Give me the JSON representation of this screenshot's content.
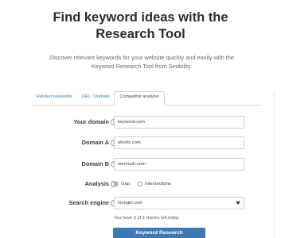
{
  "hero": {
    "title_line1": "Find keyword ideas with the",
    "title_line2": "Research Tool",
    "subtitle_line1": "Discover relevant keywords for your website quickly and easily with the",
    "subtitle_line2": "Keyword Research Tool from Seobility."
  },
  "tabs": [
    {
      "label": "Related keywords",
      "active": false
    },
    {
      "label": "URL / Domain",
      "active": false
    },
    {
      "label": "Competitor analysis",
      "active": true
    }
  ],
  "form": {
    "your_domain": {
      "label": "Your domain",
      "value": "keyword.com"
    },
    "domain_a": {
      "label": "Domain A",
      "value": "ahrefs.com"
    },
    "domain_b": {
      "label": "Domain B",
      "value": "semrush.com"
    },
    "analysis": {
      "label": "Analysis",
      "options": [
        {
          "label": "Gap",
          "checked": true
        },
        {
          "label": "Intersections",
          "checked": false
        }
      ]
    },
    "search_engine": {
      "label": "Search engine",
      "value": "Google.com"
    },
    "info_icon_glyph": "i",
    "checks_left": "You have 3 of 3 checks left today"
  },
  "actions": {
    "submit_label": "Keyword Research"
  },
  "colors": {
    "accent": "#3e79b6",
    "link": "#3f7bb8",
    "border": "#cfcfcf"
  }
}
